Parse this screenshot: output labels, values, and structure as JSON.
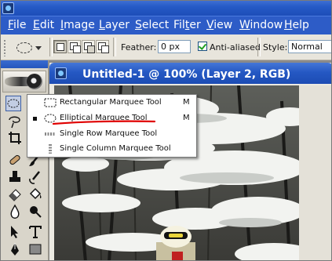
{
  "menubar": {
    "items": [
      {
        "label": "File",
        "mnemonic": "F",
        "rest": "ile"
      },
      {
        "label": "Edit",
        "mnemonic": "E",
        "rest": "dit"
      },
      {
        "label": "Image",
        "mnemonic": "I",
        "rest": "mage"
      },
      {
        "label": "Layer",
        "mnemonic": "L",
        "rest": "ayer"
      },
      {
        "label": "Select",
        "mnemonic": "S",
        "rest": "elect"
      },
      {
        "label": "Filter",
        "mnemonic": "t",
        "pre": "Fil",
        "rest": "er"
      },
      {
        "label": "View",
        "mnemonic": "V",
        "rest": "iew"
      },
      {
        "label": "Window",
        "mnemonic": "W",
        "rest": "indow"
      },
      {
        "label": "Help",
        "mnemonic": "H",
        "rest": "elp"
      }
    ]
  },
  "options": {
    "feather_label": "Feather:",
    "feather_value": "0 px",
    "antialiased_label": "Anti-aliased",
    "antialiased_checked": true,
    "style_label": "Style:",
    "style_value": "Normal"
  },
  "document": {
    "title": "Untitled-1 @ 100% (Layer 2, RGB)"
  },
  "flyout": {
    "items": [
      {
        "label": "Rectangular Marquee Tool",
        "shortcut": "M",
        "selected": false,
        "icon": "rect-marquee-icon"
      },
      {
        "label": "Elliptical Marquee Tool",
        "shortcut": "M",
        "selected": true,
        "icon": "ellipse-marquee-icon"
      },
      {
        "label": "Single Row Marquee Tool",
        "shortcut": "",
        "selected": false,
        "icon": "row-marquee-icon"
      },
      {
        "label": "Single Column Marquee Tool",
        "shortcut": "",
        "selected": false,
        "icon": "column-marquee-icon"
      }
    ]
  },
  "colors": {
    "titlebar": "#255ac6",
    "annotation": "#e00000",
    "toolbox": "#d9d5ca"
  }
}
